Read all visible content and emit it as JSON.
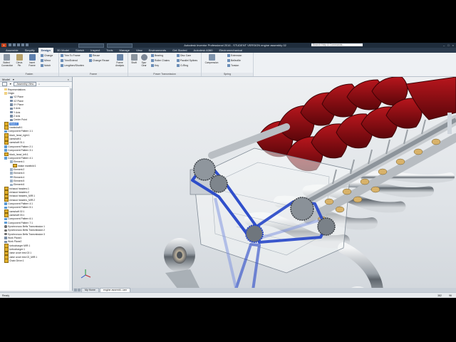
{
  "app": {
    "logo": "I",
    "title": "Autodesk Inventor Professional 2016 - STUDENT VERSION   engine assembly 02",
    "search_placeholder": "Search Help & Commands...",
    "qat_fields": [
      "Material",
      "Appearance"
    ]
  },
  "tabs": [
    "Assemble",
    "Simplify",
    "Design",
    "3D Model",
    "Sketch",
    "Inspect",
    "Tools",
    "Manage",
    "View",
    "Environments",
    "Get Started",
    "Autodesk A360",
    "Electromechanical"
  ],
  "active_tab": "Design",
  "ribbon": {
    "fasten": {
      "label": "Fasten",
      "buttons": [
        "Bolted Connection",
        "Clevis Pin",
        "Insert Frame"
      ],
      "small": [
        "Change",
        "Mirror",
        "Notch"
      ]
    },
    "frame": {
      "label": "Frame",
      "small": [
        "Trim To Frame",
        "Trim/Extend",
        "Lengthen/Shorten",
        "Reuse",
        "Change Reuse"
      ],
      "buttons": [
        "Frame Analysis"
      ]
    },
    "power": {
      "label": "Power Transmission",
      "buttons": [
        "Shaft",
        "Spur Gear"
      ],
      "small": [
        "Bearing",
        "Roller Chains",
        "Key",
        "Disc Cam",
        "Parallel Splines",
        "O-Ring"
      ]
    },
    "spring": {
      "label": "Spring",
      "buttons": [
        "Compression"
      ],
      "small": [
        "Extension",
        "Belleville",
        "Torsion"
      ]
    }
  },
  "browser": {
    "header": "Model",
    "view_label": "Assembly View",
    "rows": [
      {
        "label": "Representations",
        "indent": 1,
        "icon": "folder"
      },
      {
        "label": "Origin",
        "indent": 1,
        "icon": "folder"
      },
      {
        "label": "YZ Plane",
        "indent": 3,
        "icon": "work"
      },
      {
        "label": "XZ Plane",
        "indent": 3,
        "icon": "work"
      },
      {
        "label": "XY Plane",
        "indent": 3,
        "icon": "work"
      },
      {
        "label": "X Axis",
        "indent": 3,
        "icon": "work"
      },
      {
        "label": "Y Axis",
        "indent": 3,
        "icon": "work"
      },
      {
        "label": "Z Axis",
        "indent": 3,
        "icon": "work"
      },
      {
        "label": "Center Point",
        "indent": 3,
        "icon": "work"
      },
      {
        "label": "block:1",
        "indent": 1,
        "icon": "part",
        "hl": true
      },
      {
        "label": "crankshaft:1",
        "indent": 1,
        "icon": "part"
      },
      {
        "label": "Component Pattern 1:1",
        "indent": 1,
        "icon": "pattern"
      },
      {
        "label": "block_head_right:1",
        "indent": 1,
        "icon": "part"
      },
      {
        "label": "camshaft:1",
        "indent": 1,
        "icon": "part"
      },
      {
        "label": "camshaft 01:1",
        "indent": 1,
        "icon": "part"
      },
      {
        "label": "Component Pattern 2:1",
        "indent": 1,
        "icon": "pattern"
      },
      {
        "label": "Component Pattern 3:1",
        "indent": 1,
        "icon": "pattern"
      },
      {
        "label": "block_head_left:1",
        "indent": 1,
        "icon": "part"
      },
      {
        "label": "Component Pattern 4:1",
        "indent": 1,
        "icon": "pattern"
      },
      {
        "label": "Element:1",
        "indent": 3,
        "icon": "view"
      },
      {
        "label": "intake manifold:1",
        "indent": 4,
        "icon": "part"
      },
      {
        "label": "Element:2",
        "indent": 3,
        "icon": "view"
      },
      {
        "label": "Element:3",
        "indent": 3,
        "icon": "view"
      },
      {
        "label": "Element:4",
        "indent": 3,
        "icon": "view"
      },
      {
        "label": "Element:5",
        "indent": 3,
        "icon": "view"
      },
      {
        "label": "Element:6",
        "indent": 3,
        "icon": "view"
      },
      {
        "label": "exhaust headers:1",
        "indent": 1,
        "icon": "part"
      },
      {
        "label": "exhaust headers:2",
        "indent": 1,
        "icon": "part"
      },
      {
        "label": "exhaust headers_MIR:1",
        "indent": 1,
        "icon": "part"
      },
      {
        "label": "exhaust headers_MIR:2",
        "indent": 1,
        "icon": "part"
      },
      {
        "label": "Component Pattern 4:1",
        "indent": 1,
        "icon": "pattern"
      },
      {
        "label": "Component Pattern 5:1",
        "indent": 1,
        "icon": "pattern"
      },
      {
        "label": "camshaft 02:1",
        "indent": 1,
        "icon": "part"
      },
      {
        "label": "camshaft 03:1",
        "indent": 1,
        "icon": "part"
      },
      {
        "label": "Component Pattern 6:1",
        "indent": 1,
        "icon": "pattern"
      },
      {
        "label": "Component Pattern 7:1",
        "indent": 1,
        "icon": "pattern"
      },
      {
        "label": "Synchronous Belts Transmission:1",
        "indent": 1,
        "icon": "trans"
      },
      {
        "label": "Synchronous Belts Transmission:2",
        "indent": 1,
        "icon": "trans"
      },
      {
        "label": "Synchronous Belts Transmission:3",
        "indent": 1,
        "icon": "trans"
      },
      {
        "label": "Work Plane1",
        "indent": 1,
        "icon": "work"
      },
      {
        "label": "Work Plane2",
        "indent": 1,
        "icon": "work"
      },
      {
        "label": "turbocharger MIR:1",
        "indent": 1,
        "icon": "part"
      },
      {
        "label": "turbocharger:1",
        "indent": 1,
        "icon": "part"
      },
      {
        "label": "valve cover test 02:1",
        "indent": 1,
        "icon": "part"
      },
      {
        "label": "valve cover test 02_MIR:1",
        "indent": 1,
        "icon": "part"
      },
      {
        "label": "Chain Drive:1",
        "indent": 1,
        "icon": "part"
      }
    ]
  },
  "doc_tabs": [
    "My Home",
    "engine assembl...iam"
  ],
  "status": {
    "ready": "Ready",
    "count1": "382",
    "count2": "96"
  },
  "colors": {
    "accent": "#3d7bd6",
    "belt": "#2646c8",
    "cover": "#8b0d12"
  }
}
